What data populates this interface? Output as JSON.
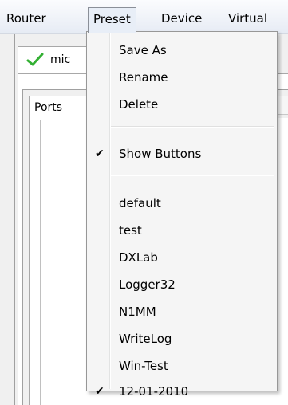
{
  "menubar": {
    "items": [
      {
        "label": "Router"
      },
      {
        "label": "Preset"
      },
      {
        "label": "Device"
      },
      {
        "label": "Virtual"
      }
    ]
  },
  "tab": {
    "label": "mic"
  },
  "inner_tab": {
    "label": "Ports"
  },
  "preset_menu": {
    "actions": [
      {
        "label": "Save As"
      },
      {
        "label": "Rename"
      },
      {
        "label": "Delete"
      }
    ],
    "options": [
      {
        "label": "Show Buttons",
        "checked": true
      }
    ],
    "presets": [
      {
        "label": "default",
        "checked": false
      },
      {
        "label": "test",
        "checked": false
      },
      {
        "label": "DXLab",
        "checked": false
      },
      {
        "label": "Logger32",
        "checked": false
      },
      {
        "label": "N1MM",
        "checked": false
      },
      {
        "label": "WriteLog",
        "checked": false
      },
      {
        "label": "Win-Test",
        "checked": false
      },
      {
        "label": "12-01-2010",
        "checked": true
      }
    ],
    "check_glyph": "✔"
  },
  "colors": {
    "check_green": "#33b033",
    "menu_bg": "#f5f5f5",
    "menubar_open_bg": "#e8eef7"
  }
}
